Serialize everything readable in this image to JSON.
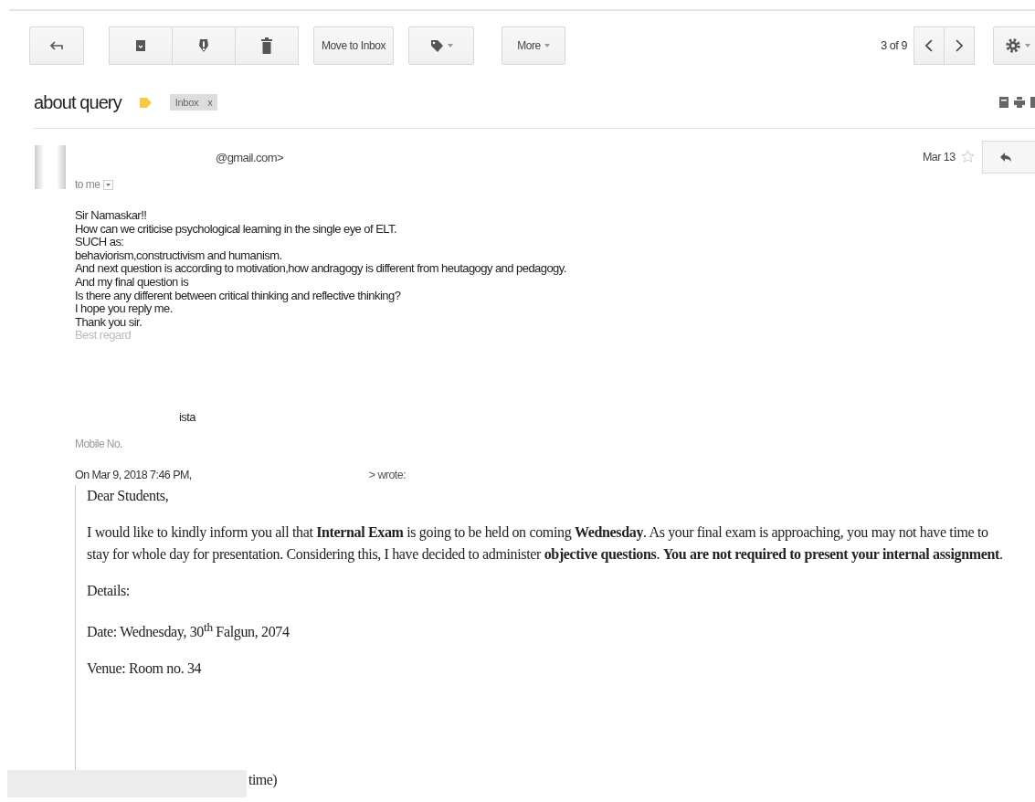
{
  "toolbar": {
    "move_label": "Move to Inbox",
    "more_label": "More",
    "pager": "3 of 9"
  },
  "subject": {
    "title": "about query",
    "important": true,
    "label": "Inbox",
    "label_close": "x"
  },
  "message": {
    "sender": "@gmail.com>",
    "recipient": "to me",
    "date": "Mar 13",
    "starred": false,
    "lines": [
      {
        "text": "Sir Namaskar!!",
        "faded": false
      },
      {
        "text": "How can we  criticise psychological learning in the single eye of ELT.",
        "faded": false
      },
      {
        "text": "SUCH as:",
        "faded": false
      },
      {
        "text": "behaviorism,constructivism and humanism.",
        "faded": false
      },
      {
        "text": "And next question is according to motivation,how andragogy is different from heutagogy and pedagogy.",
        "faded": false
      },
      {
        "text": "And my final question is",
        "faded": false
      },
      {
        "text": "Is there any different between critical thinking and reflective thinking?",
        "faded": false
      },
      {
        "text": "I hope you reply me.",
        "faded": false
      },
      {
        "text": "Thank you sir.",
        "faded": false
      },
      {
        "text": "Best regard",
        "faded": true
      }
    ],
    "signature": "ista",
    "mobile": "Mobile No.",
    "quote_header": "On Mar 9, 2018 7:46 PM,",
    "quote_wrote": "> wrote:",
    "quote": [
      "Dear Students,",
      "I would like to kindly inform you all that **Internal Exam** is going to be held on coming **Wednesday**. As your final exam is approaching, you may not have time to stay for whole day for presentation. Considering this, I have decided to administer **objective questions**. **You are not required to present your internal assignment**.",
      "Details:",
      "Date: Wednesday, 30$^{th}$ Falgun, 2074",
      "Venue: Room no. 34"
    ],
    "cut_line": "time)"
  }
}
